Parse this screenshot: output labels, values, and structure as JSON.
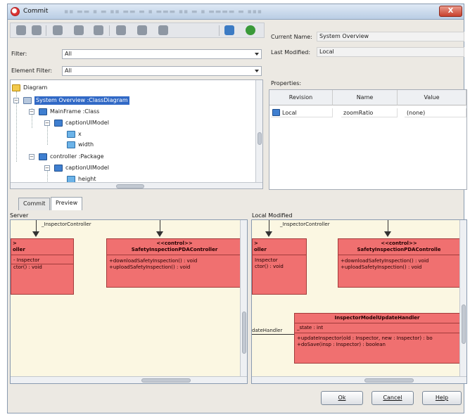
{
  "window": {
    "title": "Commit",
    "title_blur": "▪▪ ▬▬ ▪ ▬ ▪▪ ▬▬ ▬ ▪ ▬▬▬ ▪▪ ▬ ▪ ▬▬▬▬ ▬ ▪▪▪",
    "close_label": "X"
  },
  "toolbar": {
    "icons": [
      "commit-icon",
      "update-icon",
      "revert-icon",
      "lock-icon",
      "unlock-icon",
      "compare-icon",
      "history-icon",
      "branch-icon",
      "refresh-icon",
      "settings-icon"
    ]
  },
  "filters": {
    "filter_label": "Filter:",
    "filter_value": "All",
    "element_filter_label": "Element Filter:",
    "element_filter_value": "All"
  },
  "tree": {
    "items": [
      {
        "label": "Diagram",
        "icon": "folder-icon"
      },
      {
        "label": "System Overview :ClassDiagram",
        "icon": "diagram-icon"
      },
      {
        "label": "MainFrame :Class",
        "icon": "class-icon"
      },
      {
        "label": "captionUIModel",
        "icon": "class-icon"
      },
      {
        "label": "x",
        "icon": "attribute-icon"
      },
      {
        "label": "width",
        "icon": "attribute-icon"
      },
      {
        "label": "controller :Package",
        "icon": "package-icon"
      },
      {
        "label": "captionUIModel",
        "icon": "class-icon"
      },
      {
        "label": "height",
        "icon": "attribute-icon"
      }
    ]
  },
  "details": {
    "current_name_label": "Current Name:",
    "current_name_value": "System Overview",
    "last_modified_label": "Last Modified:",
    "last_modified_value": "Local",
    "properties_label": "Properties:",
    "columns": [
      "Revision",
      "Name",
      "Value"
    ],
    "rows": [
      {
        "revision": "Local",
        "name": "zoomRatio",
        "value": "(none)"
      }
    ]
  },
  "tabs": [
    "Commit",
    "Preview"
  ],
  "preview": {
    "left_label": "Server",
    "right_label": "Local Modified",
    "left": {
      "top_text": "_InspectorController",
      "class_a": {
        "header_lines": [
          ">",
          "oller"
        ],
        "rows": [
          "- Inspector",
          "ctor() : void"
        ]
      },
      "class_b": {
        "stereotype": "<<control>>",
        "name": "SafetyInspectionPDAController",
        "rows": [
          "+downloadSafetyInspection() : void",
          "+uploadSafetyInspection() : void"
        ]
      }
    },
    "right": {
      "top_text": "_InspectorController",
      "class_a": {
        "header_lines": [
          ">",
          "oller"
        ],
        "rows": [
          "Inspector",
          "ctor() : void"
        ]
      },
      "class_b": {
        "stereotype": "<<control>>",
        "name": "SafetyInspectionPDAControlle",
        "rows": [
          "+downloadSafetyInspection() : void",
          "+uploadSafetyInspection() : void"
        ]
      },
      "class_c": {
        "name": "InspectorModelUpdateHandler",
        "rows": [
          "_state : int",
          "+updateInspector(old : Inspector, new : Inspector) : bo",
          "+doSave(insp : Inspector) : boolean"
        ]
      },
      "side_text": "dateHandler"
    }
  },
  "buttons": {
    "ok": "Ok",
    "cancel": "Cancel",
    "help": "Help"
  }
}
